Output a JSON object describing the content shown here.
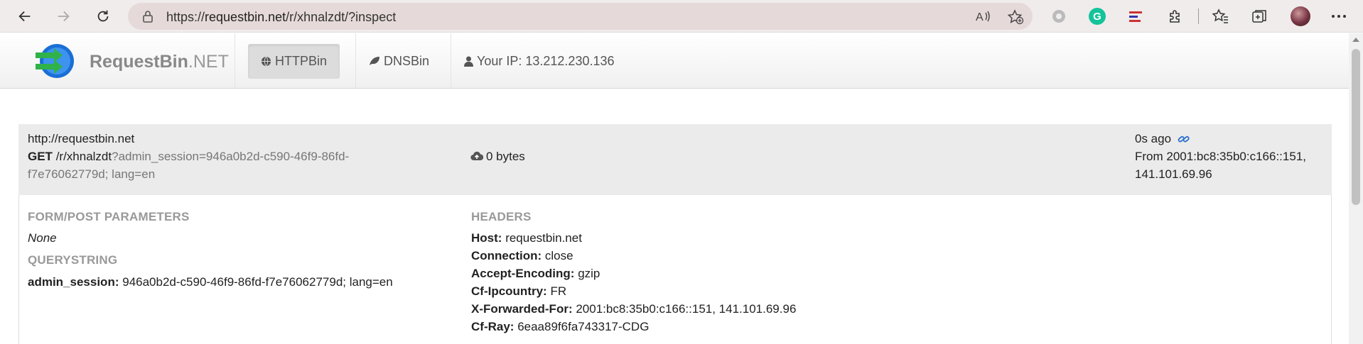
{
  "browser": {
    "url_prefix": "https://",
    "url_host": "requestbin.net",
    "url_path": "/r/xhnalzdt/?inspect"
  },
  "navbar": {
    "brand_main": "RequestBin",
    "brand_suffix": ".NET",
    "items": [
      {
        "label": "HTTPBin",
        "icon": "globe-icon"
      },
      {
        "label": "DNSBin",
        "icon": "leaf-icon"
      },
      {
        "label": "Your IP: 13.212.230.136",
        "icon": "user-icon"
      }
    ]
  },
  "request": {
    "origin": "http://requestbin.net",
    "method": "GET",
    "path": "/r/xhnalzdt",
    "query_line1": "?admin_session=946a0b2d-c590-46f9-86fd-",
    "query_line2": "f7e76062779d; lang=en",
    "size": "0 bytes",
    "age": "0s ago",
    "from_line1": "From 2001:bc8:35b0:c166::151,",
    "from_line2": "141.101.69.96"
  },
  "form": {
    "title": "FORM/POST PARAMETERS",
    "value": "None"
  },
  "querystring": {
    "title": "QUERYSTRING",
    "key": "admin_session:",
    "value": "946a0b2d-c590-46f9-86fd-f7e76062779d; lang=en"
  },
  "headers": {
    "title": "HEADERS",
    "rows": [
      {
        "key": "Host:",
        "value": "requestbin.net"
      },
      {
        "key": "Connection:",
        "value": "close"
      },
      {
        "key": "Accept-Encoding:",
        "value": "gzip"
      },
      {
        "key": "Cf-Ipcountry:",
        "value": "FR"
      },
      {
        "key": "X-Forwarded-For:",
        "value": "2001:bc8:35b0:c166::151, 141.101.69.96"
      },
      {
        "key": "Cf-Ray:",
        "value": "6eaa89f6fa743317-CDG"
      }
    ]
  }
}
